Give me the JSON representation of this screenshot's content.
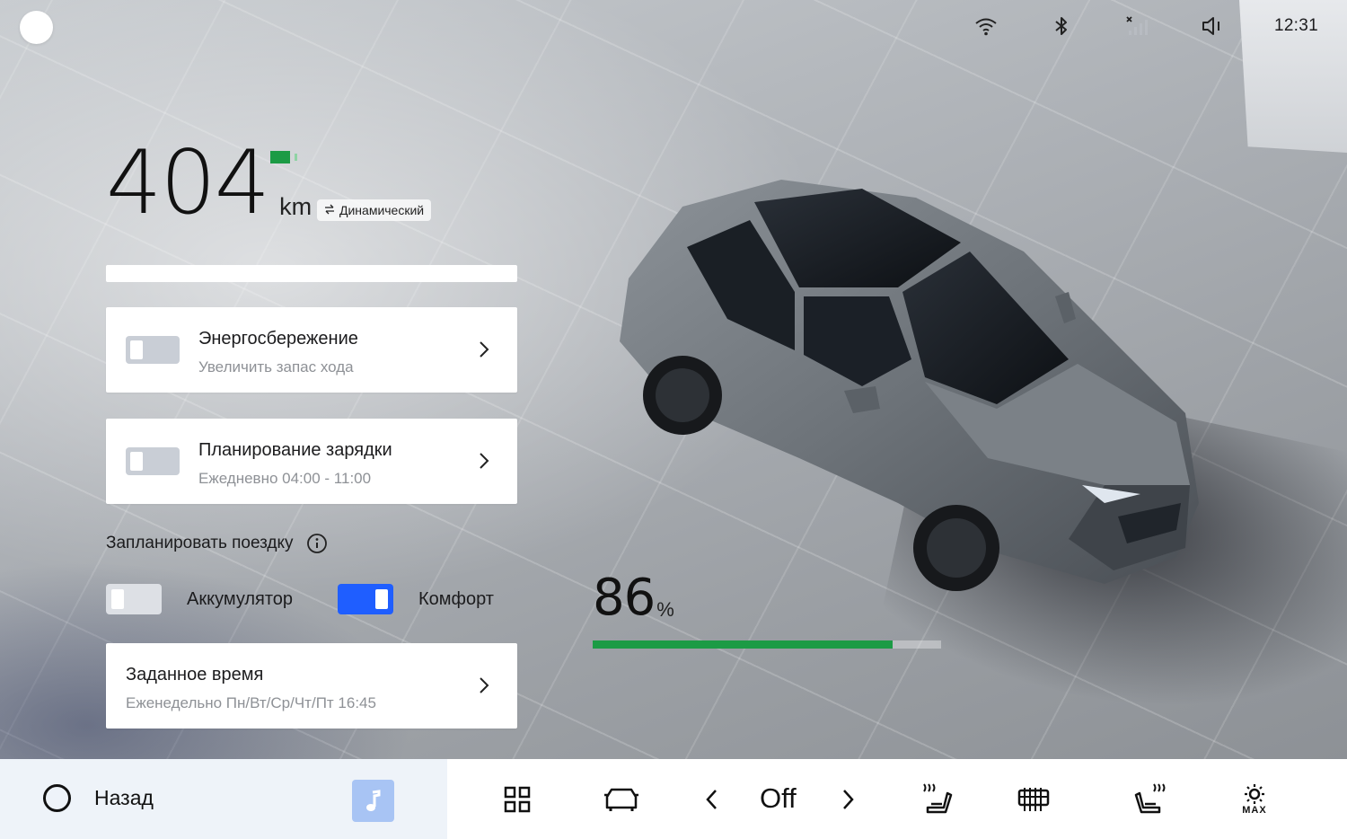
{
  "status": {
    "time": "12:31",
    "icons": [
      "wifi-icon",
      "bluetooth-icon",
      "no-signal-icon",
      "volume-muted-icon"
    ]
  },
  "range": {
    "value": "404",
    "unit": "km",
    "mode_label": "Динамический",
    "battery_mini_color": "#1c9b45"
  },
  "cards": {
    "energy_saving": {
      "title": "Энергосбережение",
      "subtitle": "Увеличить запас хода",
      "enabled": false
    },
    "charge_planning": {
      "title": "Планирование зарядки",
      "subtitle": "Ежедневно 04:00 - 11:00",
      "enabled": false
    },
    "set_time": {
      "title": "Заданное время",
      "subtitle": "Еженедельно Пн/Вт/Ср/Чт/Пт 16:45"
    }
  },
  "trip": {
    "title": "Запланировать поездку",
    "options": [
      {
        "label": "Аккумулятор",
        "enabled": false
      },
      {
        "label": "Комфорт",
        "enabled": true
      }
    ]
  },
  "battery": {
    "percent": "86",
    "unit": "%",
    "level": 0.86,
    "fill_color": "#1c9b45"
  },
  "dock": {
    "back_label": "Назад",
    "fan_value": "Off",
    "icons": [
      "apps-grid-icon",
      "car-icon",
      "chevron-left-icon",
      "chevron-right-icon",
      "seat-heat-left-icon",
      "rear-defrost-icon",
      "seat-heat-right-icon",
      "front-defrost-max-icon"
    ],
    "defrost_label": "MAX",
    "accent": "#1f5eff"
  }
}
